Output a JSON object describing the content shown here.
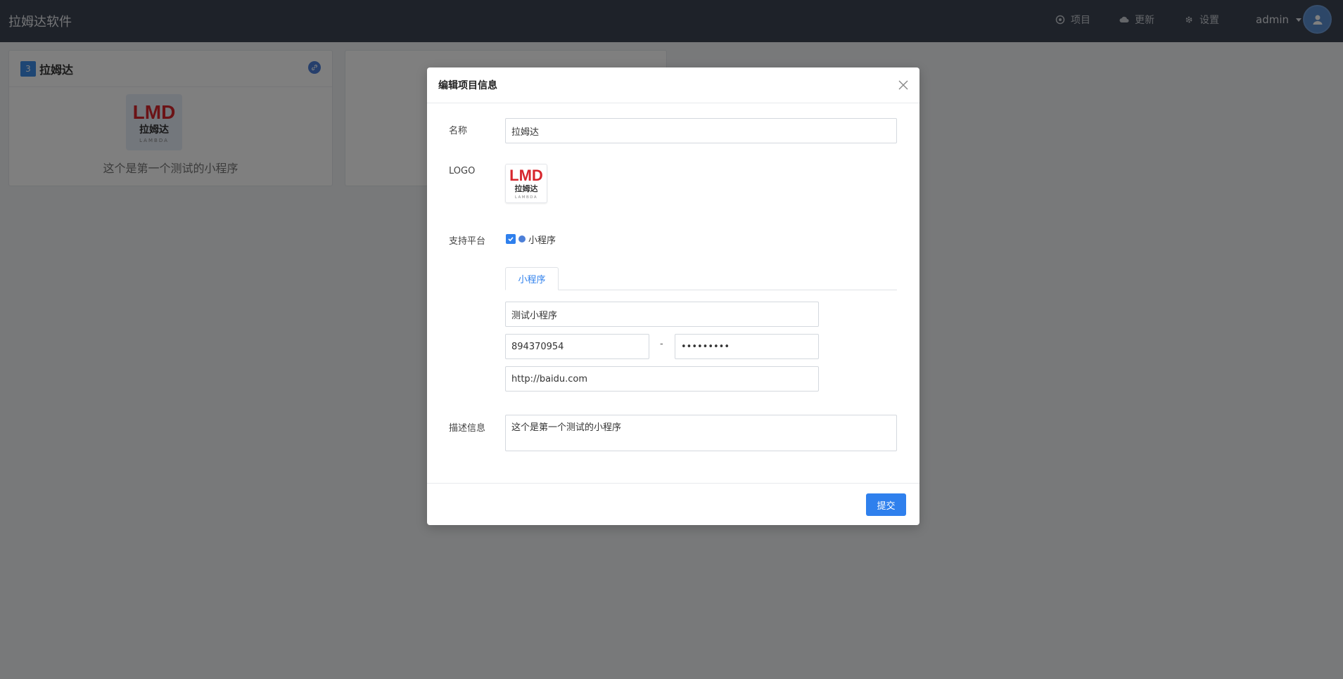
{
  "navbar": {
    "brand": "拉姆达软件",
    "items": [
      {
        "label": "项目",
        "icon": "target-icon"
      },
      {
        "label": "更新",
        "icon": "cloud-icon"
      },
      {
        "label": "设置",
        "icon": "gear-icon"
      }
    ],
    "user": "admin"
  },
  "cards": [
    {
      "number": "3",
      "title": "拉姆达",
      "logo_text": "LMD",
      "logo_sub": "拉姆达",
      "logo_caption": "LAMBDA",
      "description": "这个是第一个测试的小程序"
    }
  ],
  "modal": {
    "title": "编辑项目信息",
    "name_label": "名称",
    "name_value": "拉姆达",
    "logo_label": "LOGO",
    "logo_text": "LMD",
    "logo_sub": "拉姆达",
    "logo_caption": "LAMBDA",
    "platform_label": "支持平台",
    "platform_option": "小程序",
    "platform_checked": true,
    "tab_label": "小程序",
    "app_name_value": "测试小程序",
    "app_id_value": "894370954",
    "separator": "-",
    "app_secret_value": "•••••••••",
    "url_value": "http://baidu.com",
    "description_label": "描述信息",
    "description_value": "这个是第一个测试的小程序",
    "submit_label": "提交"
  },
  "colors": {
    "navbar": "#3c4452",
    "primary": "#2f80ed",
    "logo_red": "#d7262d"
  }
}
